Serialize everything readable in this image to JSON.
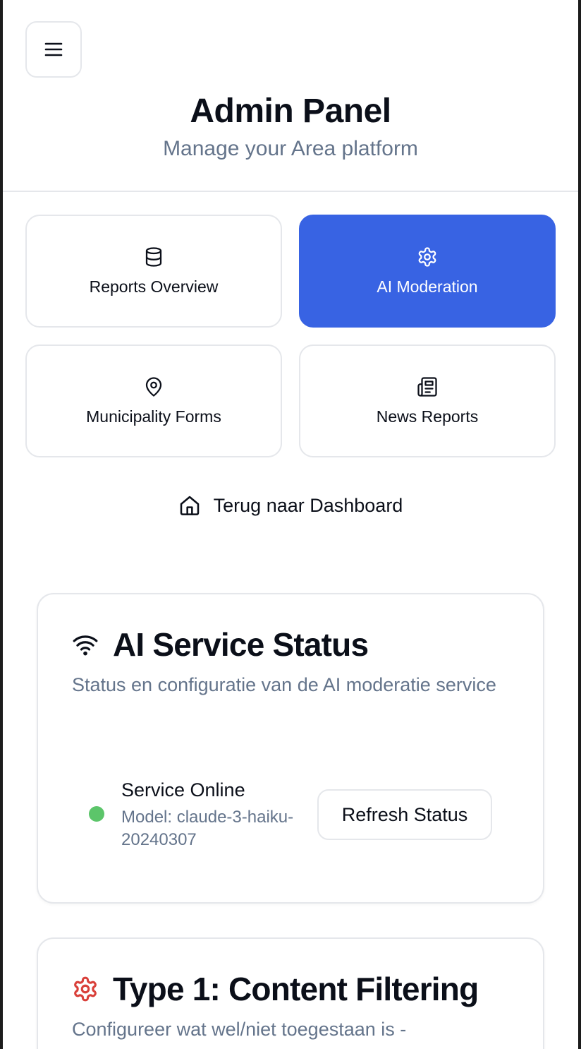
{
  "header": {
    "menu_icon": "hamburger-menu-icon",
    "title": "Admin Panel",
    "subtitle": "Manage your Area platform"
  },
  "nav": {
    "items": [
      {
        "label": "Reports Overview",
        "icon": "database-icon",
        "active": false
      },
      {
        "label": "AI Moderation",
        "icon": "gear-icon",
        "active": true
      },
      {
        "label": "Municipality Forms",
        "icon": "map-pin-icon",
        "active": false
      },
      {
        "label": "News Reports",
        "icon": "newspaper-icon",
        "active": false
      }
    ],
    "back_label": "Terug naar Dashboard",
    "back_icon": "home-icon"
  },
  "service_status": {
    "icon": "wifi-icon",
    "title": "AI Service Status",
    "description": "Status en configuratie van de AI moderatie service",
    "status_label": "Service Online",
    "model_text": "Model: claude-3-haiku-20240307",
    "refresh_label": "Refresh Status"
  },
  "content_filtering": {
    "icon": "gear-icon",
    "title": "Type 1: Content Filtering",
    "description": "Configureer wat wel/niet toegestaan is -"
  },
  "colors": {
    "accent": "#3863e3",
    "status_online": "#5cc56a",
    "filter_icon": "#d9403a",
    "muted_text": "#64748b",
    "border": "#e5e7eb"
  }
}
